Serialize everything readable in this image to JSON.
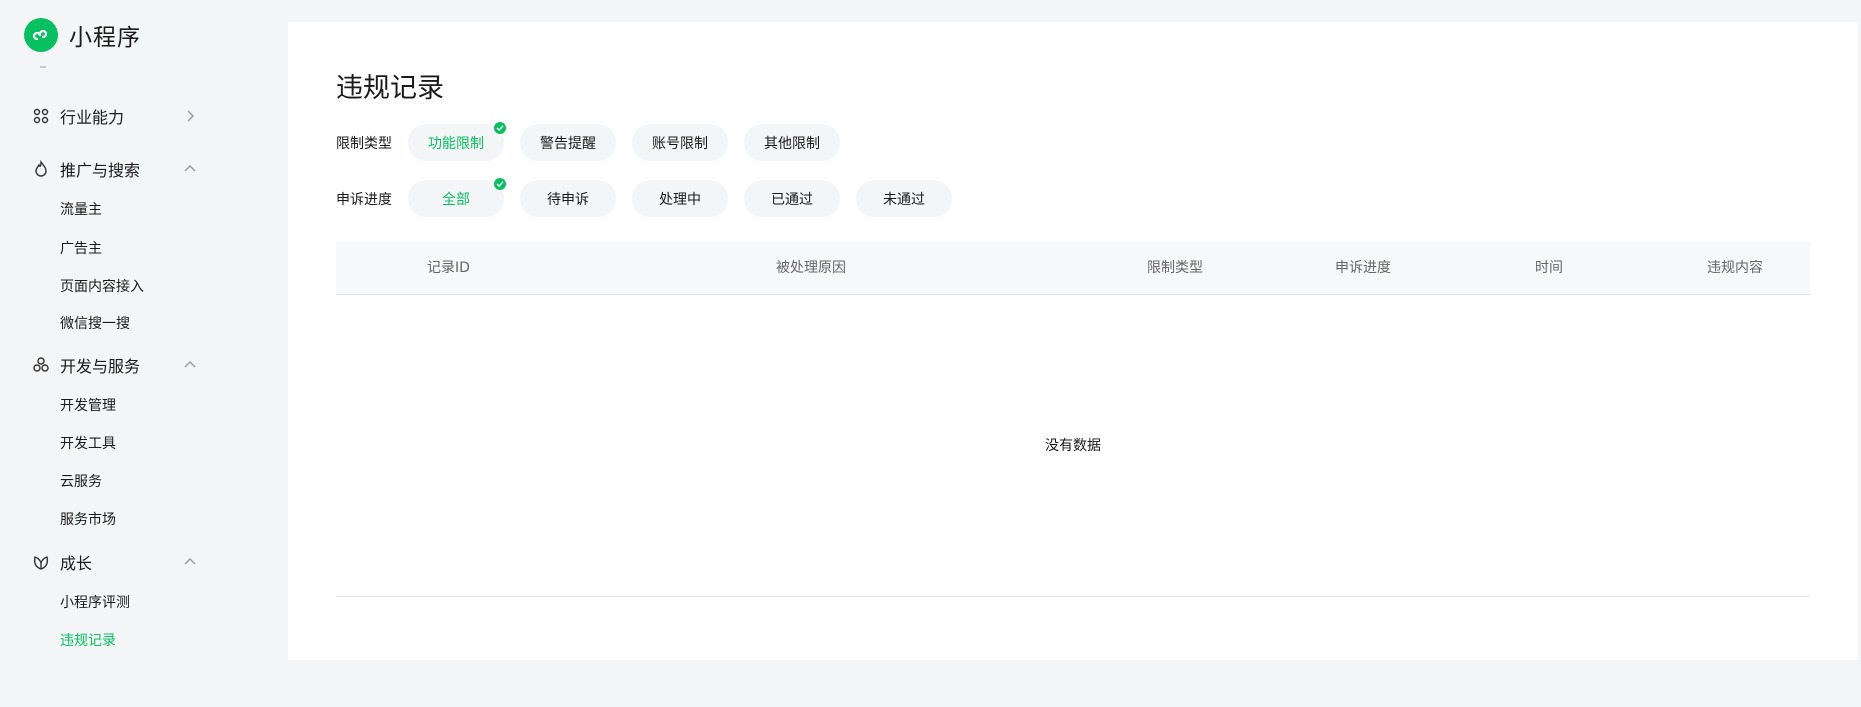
{
  "app": {
    "name": "小程序"
  },
  "sidebar": {
    "groups": [
      {
        "label": "行业能力",
        "expanded": false,
        "items": []
      },
      {
        "label": "推广与搜索",
        "expanded": true,
        "items": [
          "流量主",
          "广告主",
          "页面内容接入",
          "微信搜一搜"
        ]
      },
      {
        "label": "开发与服务",
        "expanded": true,
        "items": [
          "开发管理",
          "开发工具",
          "云服务",
          "服务市场"
        ]
      },
      {
        "label": "成长",
        "expanded": true,
        "items": [
          "小程序评测",
          "违规记录"
        ]
      }
    ],
    "active_item": "违规记录"
  },
  "page": {
    "title": "违规记录",
    "filters": {
      "restriction_type": {
        "label": "限制类型",
        "options": [
          "功能限制",
          "警告提醒",
          "账号限制",
          "其他限制"
        ],
        "selected": "功能限制"
      },
      "appeal_progress": {
        "label": "申诉进度",
        "options": [
          "全部",
          "待申诉",
          "处理中",
          "已通过",
          "未通过"
        ],
        "selected": "全部"
      }
    },
    "table": {
      "columns": [
        "记录ID",
        "被处理原因",
        "限制类型",
        "申诉进度",
        "时间",
        "违规内容"
      ],
      "rows": [],
      "empty_text": "没有数据"
    }
  },
  "colors": {
    "accent": "#07c160",
    "background": "#f4f5f7",
    "card": "#ffffff"
  }
}
